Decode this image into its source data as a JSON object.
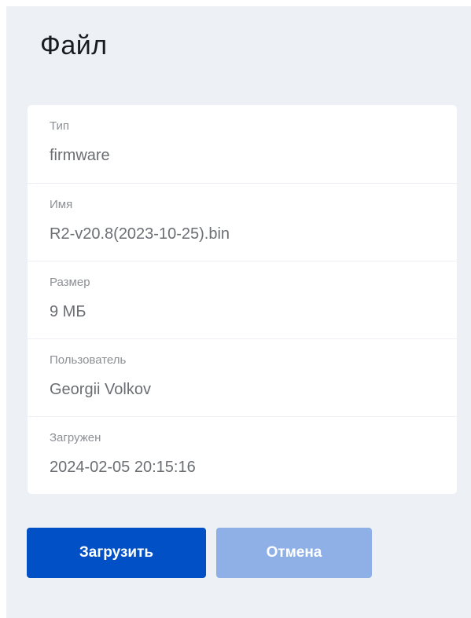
{
  "dialog": {
    "title": "Файл"
  },
  "fields": [
    {
      "label": "Тип",
      "value": "firmware"
    },
    {
      "label": "Имя",
      "value": "R2-v20.8(2023-10-25).bin"
    },
    {
      "label": "Размер",
      "value": "9 МБ"
    },
    {
      "label": "Пользователь",
      "value": "Georgii Volkov"
    },
    {
      "label": "Загружен",
      "value": "2024-02-05 20:15:16"
    }
  ],
  "actions": {
    "upload_label": "Загрузить",
    "cancel_label": "Отмена"
  },
  "colors": {
    "panel_background": "#edf0f5",
    "primary_button": "#0250c5",
    "secondary_button": "#8fb0e6"
  }
}
